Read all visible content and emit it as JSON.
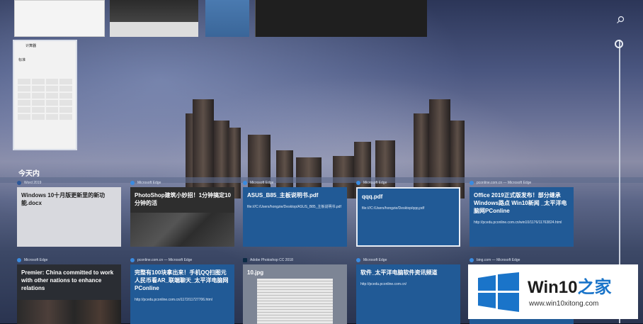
{
  "timeline": {
    "section_title": "今天内",
    "section_subtitle": "",
    "year_label": "",
    "search_icon": "search-icon"
  },
  "calculator_window": {
    "title": "计算器",
    "display": "标准"
  },
  "cards_row1": [
    {
      "source": "Word 2019",
      "title": "Windows 10十月版更新里的新功能.docx",
      "url": "",
      "style": "light"
    },
    {
      "source": "Microsoft Edge",
      "title": "PhotoShop建筑小妙招！1分钟搞定10分钟的活",
      "url": "",
      "style": "image"
    },
    {
      "source": "Microsoft Edge",
      "title": "ASUS_B85_主板说明书.pdf",
      "url": "file:///C:/Users/hongzie/Desktop/ASUS_B85_主板说明书.pdf",
      "style": "blue"
    },
    {
      "source": "Microsoft Edge",
      "title": "qqq.pdf",
      "url": "file:///C:/Users/hongzie/Desktop/qqq.pdf",
      "style": "blue-selected"
    },
    {
      "source": "pconline.com.cn — Microsoft Edge",
      "title": "Office 2019正式版发布！部分继承Windows路点 Win10新闻 _太平洋电脑网PConline",
      "url": "http://pcedu.pconline.com.cn/win10/1176/11763824.html",
      "style": "blue"
    }
  ],
  "cards_row2": [
    {
      "source": "Microsoft Edge",
      "title": "Premier: China committed to work with other nations to enhance relations",
      "url": "",
      "style": "people"
    },
    {
      "source": "pconline.com.cn — Microsoft Edge",
      "title": "完整有100块拿出来！手机QQ扫图元人民币看AR_联端聊天_太平洋电脑网PConline",
      "url": "http://pcedu.pconline.com.cn/1172/11727706.html",
      "style": "blue"
    },
    {
      "source": "Adobe Photoshop CC 2018",
      "title": "10.jpg",
      "url": "",
      "style": "doc"
    },
    {
      "source": "Microsoft Edge",
      "title": "软件_太平洋电脑软件资讯频道",
      "url": "http://pcedu.pconline.com.cn/",
      "style": "blue"
    },
    {
      "source": "bing.com — Microsoft Edge",
      "title": "",
      "url": "",
      "style": "blue"
    }
  ],
  "watermark": {
    "name_latin": "Win10",
    "name_zh": "之家",
    "url": "www.win10xitong.com"
  },
  "colors": {
    "card_blue": "#215a96",
    "edge_icon": "#3a8be0",
    "watermark_blue": "#1a74c9"
  }
}
